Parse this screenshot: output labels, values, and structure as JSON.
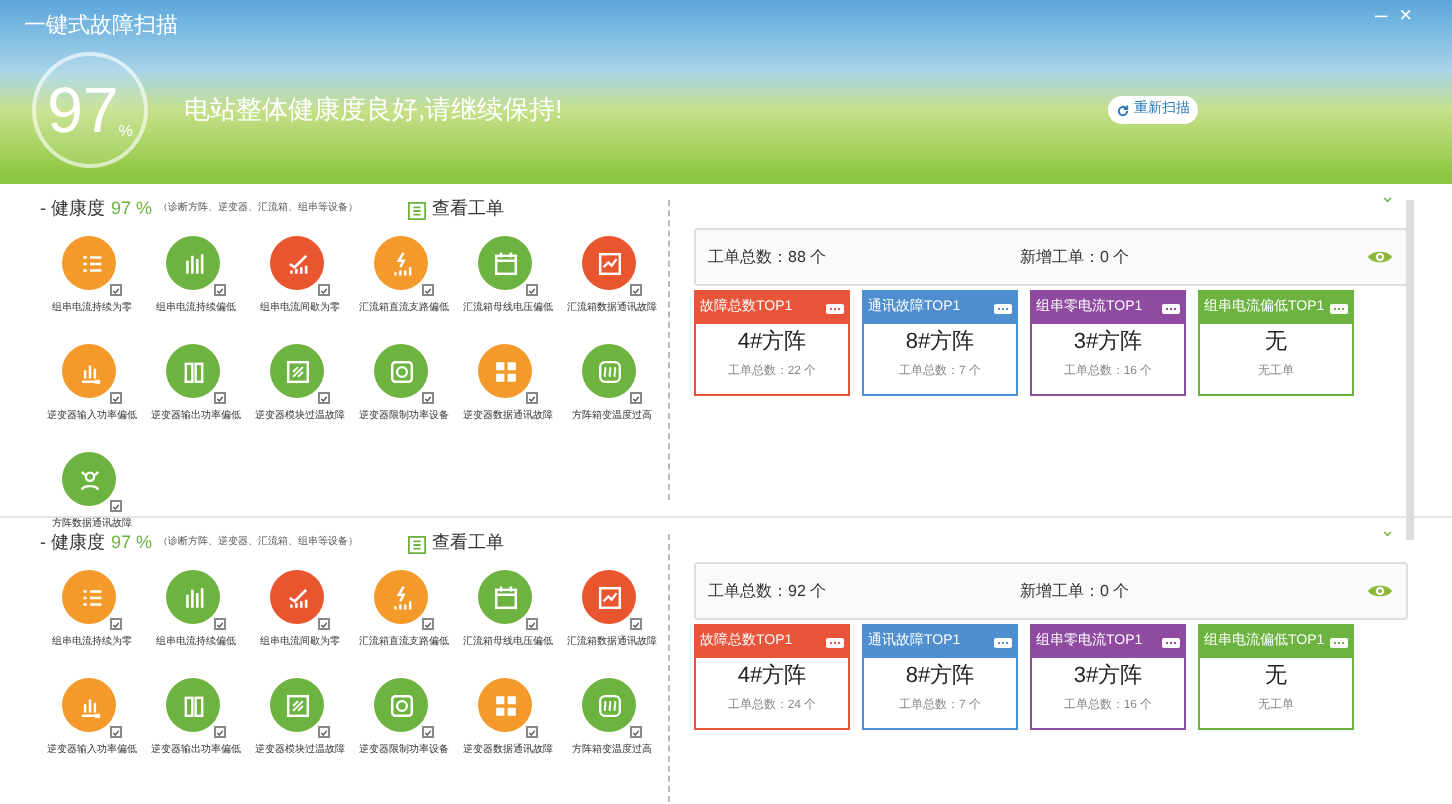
{
  "window": {
    "title": "一键式故障扫描",
    "controls": [
      "–",
      "×"
    ]
  },
  "banner": {
    "score": "97",
    "unit": "%",
    "message": "电站整体健康度良好,请继续保持!",
    "rescan_button": "重新扫描"
  },
  "sections": [
    {
      "label": "- 健康度",
      "score": "97 %",
      "scope": "（诊断方阵、逆变器、汇流箱、组串等设备）",
      "orders_link": "查看工单",
      "collapse_icon": "⌄",
      "checks": [
        {
          "kind": "list",
          "color": "#f39a2b",
          "checked": true,
          "label": "组串电流持续为零"
        },
        {
          "kind": "bars",
          "color": "#6db33f",
          "checked": true,
          "label": "组串电流持续偏低"
        },
        {
          "kind": "trend",
          "color": "#e8552f",
          "checked": true,
          "label": "组串电流间歇为零"
        },
        {
          "kind": "bolt",
          "color": "#f39a2b",
          "checked": true,
          "label": "汇流箱直流支路偏低"
        },
        {
          "kind": "calendar",
          "color": "#6db33f",
          "checked": true,
          "label": "汇流箱母线电压偏低"
        },
        {
          "kind": "frame",
          "color": "#e8552f",
          "checked": true,
          "label": "汇流箱数据通讯故障"
        },
        {
          "kind": "barx",
          "color": "#f39a2b",
          "checked": true,
          "label": "逆变器输入功率偏低"
        },
        {
          "kind": "columns",
          "color": "#6db33f",
          "checked": true,
          "label": "逆变器输出功率偏低"
        },
        {
          "kind": "hatch",
          "color": "#6db33f",
          "checked": true,
          "label": "逆变器模块过温故障"
        },
        {
          "kind": "disk",
          "color": "#6db33f",
          "checked": true,
          "label": "逆变器限制功率设备"
        },
        {
          "kind": "grid",
          "color": "#f39a2b",
          "checked": true,
          "label": "逆变器数据通讯故障"
        },
        {
          "kind": "waves",
          "color": "#6db33f",
          "checked": true,
          "label": "方阵箱变温度过高"
        },
        {
          "kind": "people",
          "color": "#6db33f",
          "checked": true,
          "label": "方阵数据通讯故障"
        }
      ],
      "summary": {
        "total": "工单总数：88 个",
        "new": "新增工单：0 个"
      },
      "cards": [
        {
          "title": "故障总数TOP1",
          "color": "#e8553a",
          "value": "4#方阵",
          "detail": "工单总数：22 个"
        },
        {
          "title": "通讯故障TOP1",
          "color": "#4f8fcf",
          "value": "8#方阵",
          "detail": "工单总数：7 个"
        },
        {
          "title": "组串零电流TOP1",
          "color": "#8e4b9f",
          "value": "3#方阵",
          "detail": "工单总数：16 个"
        },
        {
          "title": "组串电流偏低TOP1",
          "color": "#6db33f",
          "value": "无",
          "detail": "无工单"
        }
      ]
    },
    {
      "label": "- 健康度",
      "score": "97 %",
      "scope": "（诊断方阵、逆变器、汇流箱、组串等设备）",
      "orders_link": "查看工单",
      "collapse_icon": "⌄",
      "checks": [
        {
          "kind": "list",
          "color": "#f39a2b",
          "checked": true,
          "label": "组串电流持续为零"
        },
        {
          "kind": "bars",
          "color": "#6db33f",
          "checked": true,
          "label": "组串电流持续偏低"
        },
        {
          "kind": "trend",
          "color": "#e8552f",
          "checked": true,
          "label": "组串电流间歇为零"
        },
        {
          "kind": "bolt",
          "color": "#f39a2b",
          "checked": true,
          "label": "汇流箱直流支路偏低"
        },
        {
          "kind": "calendar",
          "color": "#6db33f",
          "checked": true,
          "label": "汇流箱母线电压偏低"
        },
        {
          "kind": "frame",
          "color": "#e8552f",
          "checked": true,
          "label": "汇流箱数据通讯故障"
        },
        {
          "kind": "barx",
          "color": "#f39a2b",
          "checked": true,
          "label": "逆变器输入功率偏低"
        },
        {
          "kind": "columns",
          "color": "#6db33f",
          "checked": true,
          "label": "逆变器输出功率偏低"
        },
        {
          "kind": "hatch",
          "color": "#6db33f",
          "checked": true,
          "label": "逆变器模块过温故障"
        },
        {
          "kind": "disk",
          "color": "#6db33f",
          "checked": true,
          "label": "逆变器限制功率设备"
        },
        {
          "kind": "grid",
          "color": "#f39a2b",
          "checked": true,
          "label": "逆变器数据通讯故障"
        },
        {
          "kind": "waves",
          "color": "#6db33f",
          "checked": true,
          "label": "方阵箱变温度过高"
        }
      ],
      "summary": {
        "total": "工单总数：92 个",
        "new": "新增工单：0 个"
      },
      "cards": [
        {
          "title": "故障总数TOP1",
          "color": "#e8553a",
          "value": "4#方阵",
          "detail": "工单总数：24 个"
        },
        {
          "title": "通讯故障TOP1",
          "color": "#4f8fcf",
          "value": "8#方阵",
          "detail": "工单总数：7 个"
        },
        {
          "title": "组串零电流TOP1",
          "color": "#8e4b9f",
          "value": "3#方阵",
          "detail": "工单总数：16 个"
        },
        {
          "title": "组串电流偏低TOP1",
          "color": "#6db33f",
          "value": "无",
          "detail": "无工单"
        }
      ]
    }
  ]
}
